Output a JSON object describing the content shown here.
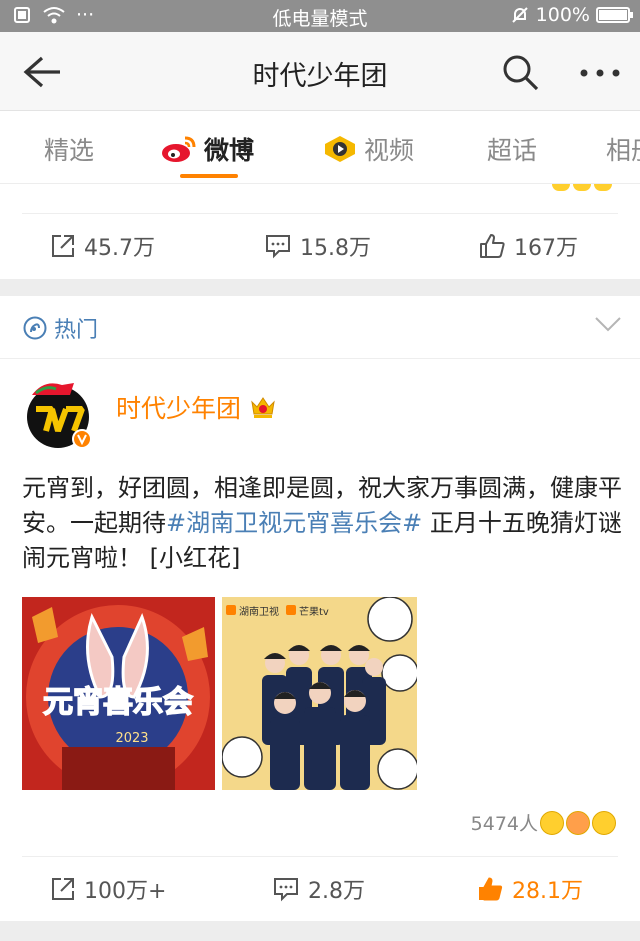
{
  "status_bar": {
    "mode": "低电量模式",
    "battery": "100%",
    "more": "···"
  },
  "nav": {
    "title": "时代少年团"
  },
  "tabs": [
    {
      "label": "精选"
    },
    {
      "label": "微博"
    },
    {
      "label": "视频"
    },
    {
      "label": "超话"
    },
    {
      "label": "相册"
    }
  ],
  "prev_card": {
    "repost": "45.7万",
    "comment": "15.8万",
    "like": "167万"
  },
  "section": {
    "label": "热门"
  },
  "post": {
    "author": "时代少年团",
    "text_pre": "元宵到，好团圆，相逢即是圆，祝大家万事圆满，健康平安。一起期待",
    "hashtag": "#湖南卫视元宵喜乐会#",
    "text_post": " 正月十五晚猜灯谜闹元宵啦！ [小红花]",
    "images": [
      {
        "title": "元宵喜乐会",
        "year": "2023"
      },
      {
        "brand1": "湖南卫视",
        "brand2": "芒果tv"
      }
    ],
    "reaction_count": "5474人",
    "actions": {
      "repost": "100万+",
      "comment": "2.8万",
      "like": "28.1万"
    }
  },
  "colors": {
    "accent": "#ff8200",
    "link": "#4a7fb5"
  }
}
